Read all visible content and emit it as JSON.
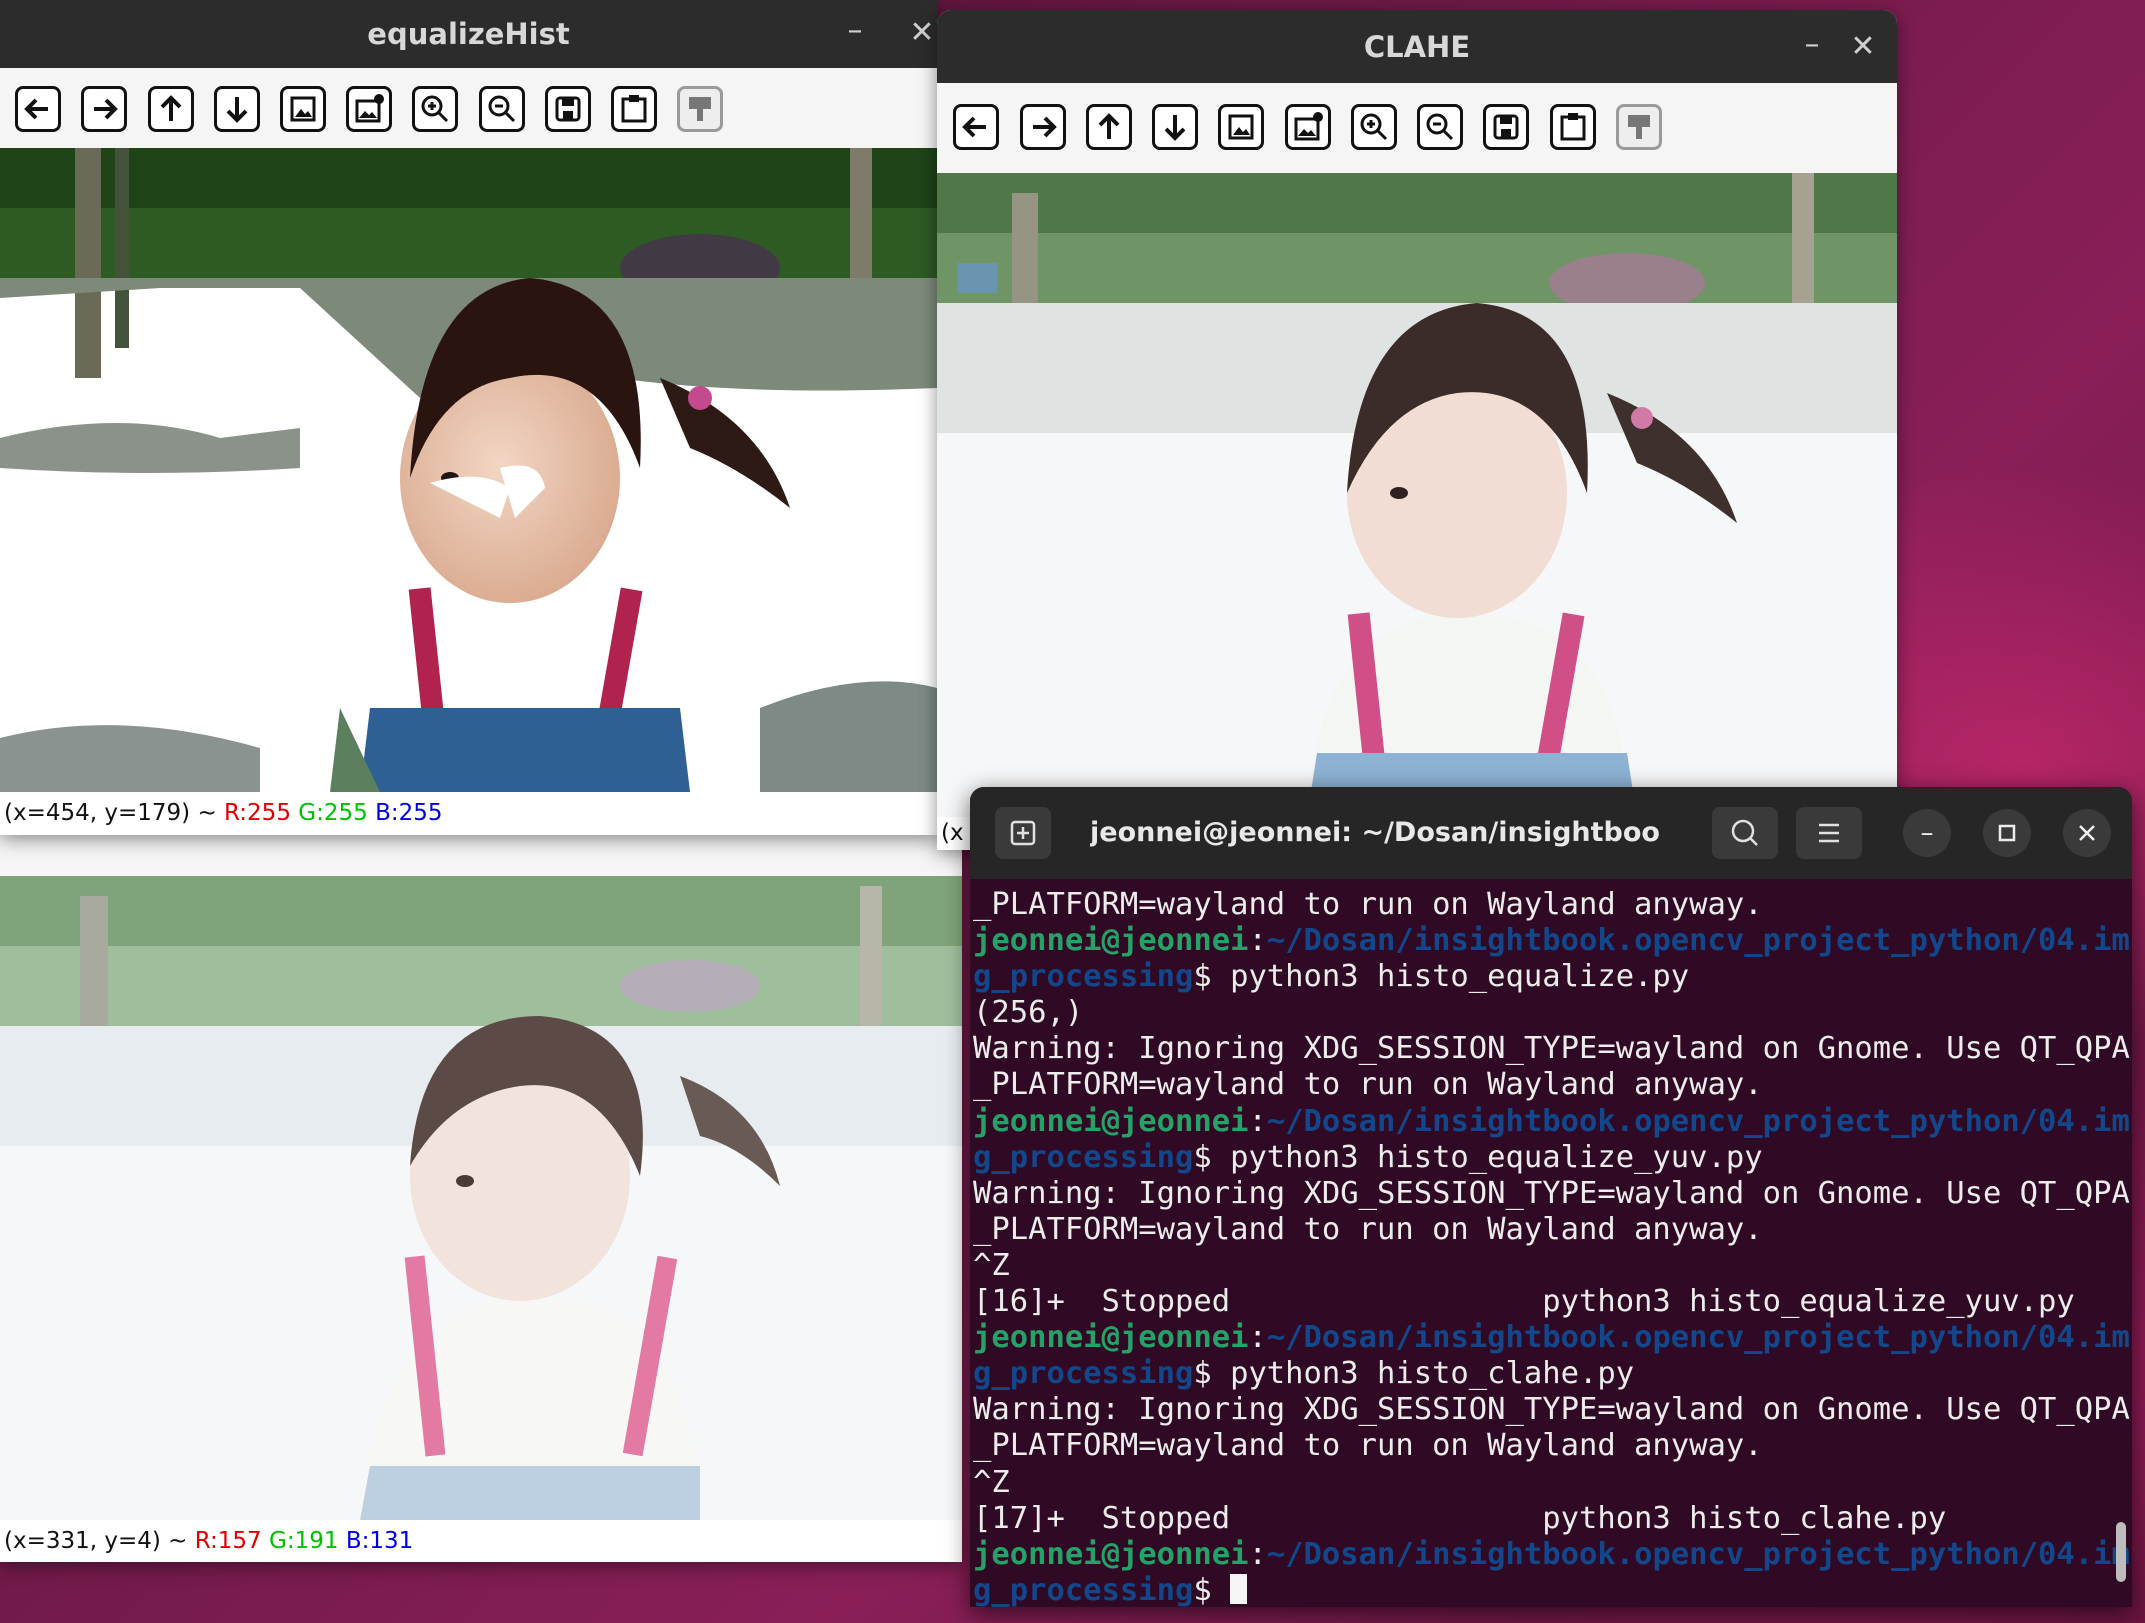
{
  "windows": {
    "equalize": {
      "title": "equalizeHist",
      "status": {
        "coords": "(x=454, y=179) ~ ",
        "r": "R:255",
        "g": "G:255",
        "b": "B:255"
      }
    },
    "clahe": {
      "title": "CLAHE",
      "status_partial": "(x"
    },
    "bottom": {
      "status": {
        "coords": "(x=331, y=4) ~ ",
        "r": "R:157",
        "g": "G:191",
        "b": "B:131"
      }
    }
  },
  "toolbar_icons": [
    "arrow-left-icon",
    "arrow-right-icon",
    "arrow-up-icon",
    "arrow-down-icon",
    "image-icon",
    "image-options-icon",
    "zoom-in-icon",
    "zoom-out-icon",
    "save-icon",
    "clipboard-icon",
    "properties-icon"
  ],
  "terminal": {
    "title": "jeonnei@jeonnei: ~/Dosan/insightboo...",
    "lines": [
      {
        "text": "_PLATFORM=wayland to run on Wayland anyway."
      },
      {
        "user": "jeonnei@jeonnei",
        "path": "~/Dosan/insightbook.opencv_project_python/04.im"
      },
      {
        "path": "g_processing",
        "text": "$ python3 histo_equalize.py"
      },
      {
        "text": "(256,)"
      },
      {
        "text": "Warning: Ignoring XDG_SESSION_TYPE=wayland on Gnome. Use QT_QPA"
      },
      {
        "text": "_PLATFORM=wayland to run on Wayland anyway."
      },
      {
        "user": "jeonnei@jeonnei",
        "path": "~/Dosan/insightbook.opencv_project_python/04.im"
      },
      {
        "path": "g_processing",
        "text": "$ python3 histo_equalize_yuv.py"
      },
      {
        "text": "Warning: Ignoring XDG_SESSION_TYPE=wayland on Gnome. Use QT_QPA"
      },
      {
        "text": "_PLATFORM=wayland to run on Wayland anyway."
      },
      {
        "text": "^Z"
      },
      {
        "text": "[16]+  Stopped                 python3 histo_equalize_yuv.py"
      },
      {
        "user": "jeonnei@jeonnei",
        "path": "~/Dosan/insightbook.opencv_project_python/04.im"
      },
      {
        "path": "g_processing",
        "text": "$ python3 histo_clahe.py"
      },
      {
        "text": "Warning: Ignoring XDG_SESSION_TYPE=wayland on Gnome. Use QT_QPA"
      },
      {
        "text": "_PLATFORM=wayland to run on Wayland anyway."
      },
      {
        "text": "^Z"
      },
      {
        "text": "[17]+  Stopped                 python3 histo_clahe.py"
      },
      {
        "user": "jeonnei@jeonnei",
        "path": "~/Dosan/insightbook.opencv_project_python/04.im"
      },
      {
        "path": "g_processing",
        "text": "$ ",
        "cursor": true
      }
    ]
  },
  "colors": {
    "terminal_bg": "#300a24",
    "prompt_user": "#26a269",
    "prompt_path": "#12488b",
    "titlebar": "#2c2c2c"
  }
}
